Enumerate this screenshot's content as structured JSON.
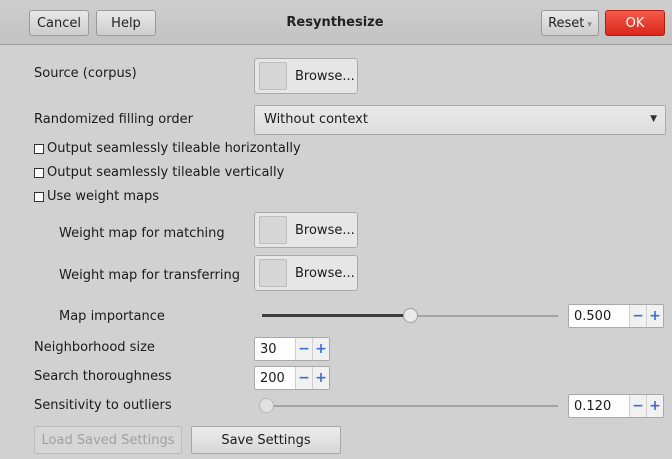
{
  "window": {
    "title": "Resynthesize"
  },
  "titlebar": {
    "cancel_label": "Cancel",
    "help_label": "Help",
    "reset_label": "Reset",
    "ok_label": "OK"
  },
  "source": {
    "label": "Source (corpus)",
    "browse_label": "Browse..."
  },
  "filling_order": {
    "label": "Randomized filling order",
    "selected": "Without context"
  },
  "options": [
    {
      "label": "Output seamlessly tileable horizontally",
      "checked": false
    },
    {
      "label": "Output seamlessly tileable vertically",
      "checked": false
    },
    {
      "label": "Use weight maps",
      "checked": false
    }
  ],
  "weight_maps": {
    "matching_label": "Weight map for matching",
    "matching_browse": "Browse...",
    "transferring_label": "Weight map for transferring",
    "transferring_browse": "Browse..."
  },
  "map_importance": {
    "label": "Map importance",
    "value": "0.500",
    "fraction": 0.5
  },
  "neighborhood": {
    "label": "Neighborhood size",
    "value": "30"
  },
  "thoroughness": {
    "label": "Search thoroughness",
    "value": "200"
  },
  "sensitivity": {
    "label": "Sensitivity to outliers",
    "value": "0.120",
    "fraction": 0.0
  },
  "footer": {
    "load_label": "Load Saved Settings",
    "save_label": "Save Settings"
  },
  "icons": {
    "minus": "−",
    "plus": "+",
    "dropdown": "▼"
  },
  "colors": {
    "ok_button": "#e0382a",
    "spin_buttons": "#3a6fcf"
  }
}
